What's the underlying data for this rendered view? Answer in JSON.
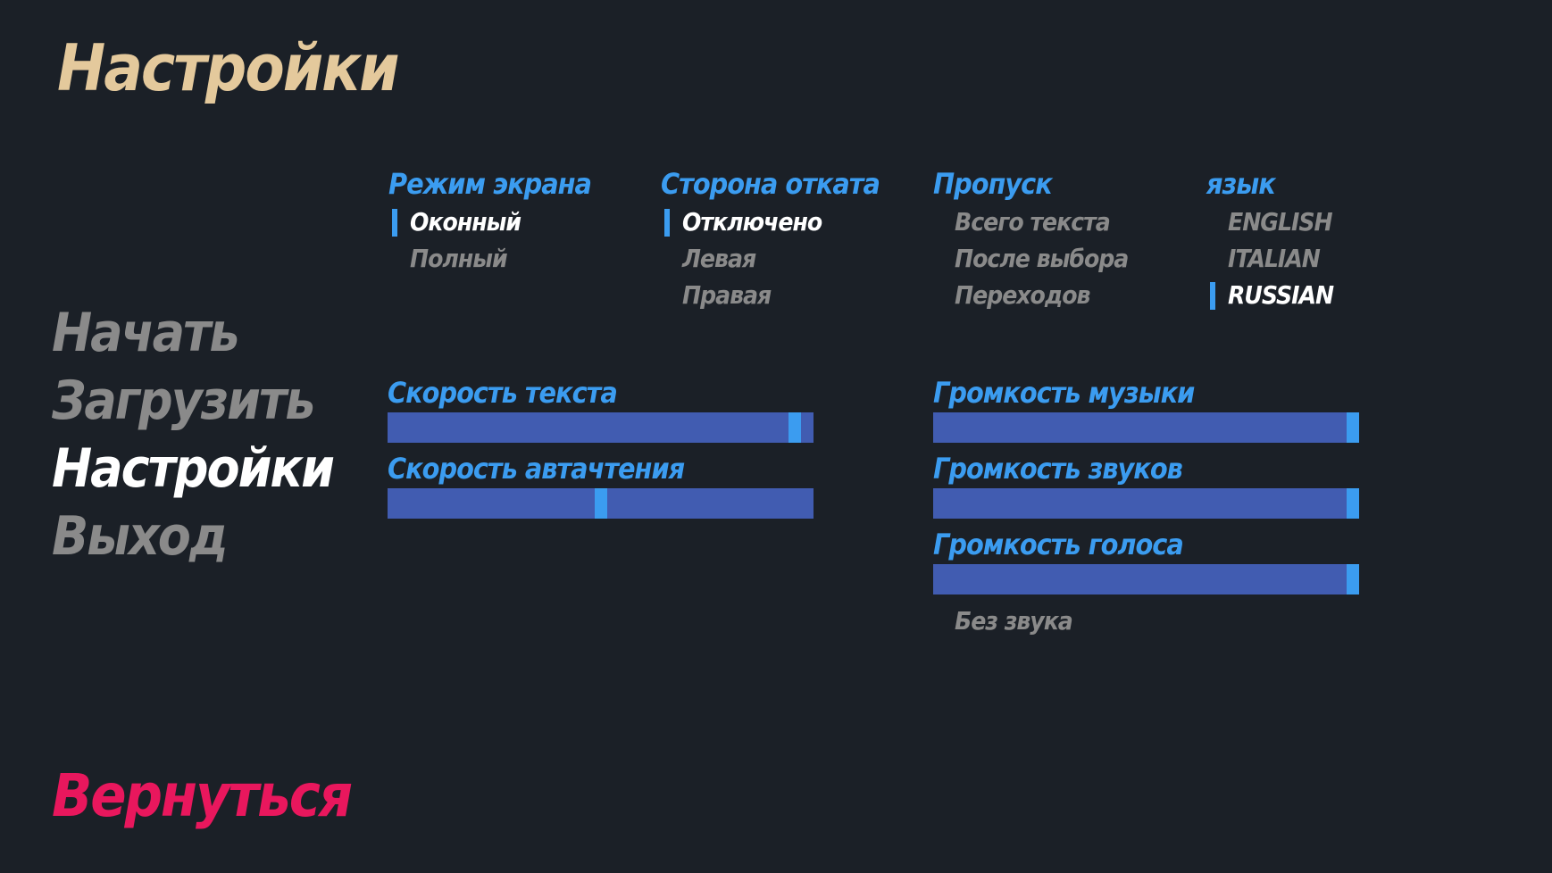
{
  "title": "Настройки",
  "main_menu": {
    "items": [
      {
        "label": "Начать",
        "active": false
      },
      {
        "label": "Загрузить",
        "active": false
      },
      {
        "label": "Настройки",
        "active": true
      },
      {
        "label": "Выход",
        "active": false
      }
    ]
  },
  "return_label": "Вернуться",
  "prefs": {
    "display": {
      "label": "Режим экрана",
      "options": [
        "Оконный",
        "Полный"
      ],
      "selected": 0
    },
    "rollback": {
      "label": "Сторона отката",
      "options": [
        "Отключено",
        "Левая",
        "Правая"
      ],
      "selected": 0
    },
    "skip": {
      "label": "Пропуск",
      "options": [
        "Всего текста",
        "После выбора",
        "Переходов"
      ],
      "selected": -1
    },
    "language": {
      "label": "язык",
      "options": [
        "ENGLISH",
        "ITALIAN",
        "RUSSIAN"
      ],
      "selected": 2
    }
  },
  "sliders": {
    "text_speed": {
      "label": "Скорость текста",
      "value": 0.97
    },
    "auto_forward": {
      "label": "Скорость автачтения",
      "value": 0.5
    },
    "music_volume": {
      "label": "Громкость музыки",
      "value": 1.0
    },
    "sound_volume": {
      "label": "Громкость звуков",
      "value": 1.0
    },
    "voice_volume": {
      "label": "Громкость голоса",
      "value": 1.0
    }
  },
  "mute_label": "Без звука",
  "colors": {
    "background": "#1b2027",
    "title": "#e4c99c",
    "accent": "#3b9cf0",
    "bar": "#415cb1",
    "return": "#e9175d",
    "inactive": "#8a8a8a",
    "active": "#ffffff"
  }
}
